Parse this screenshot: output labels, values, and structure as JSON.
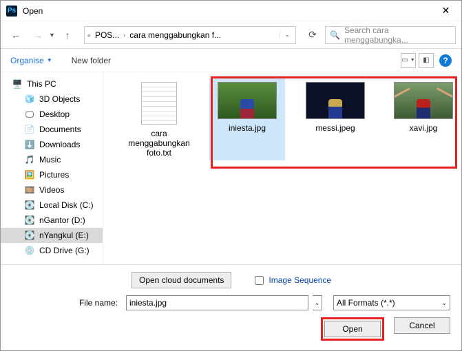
{
  "title": "Open",
  "breadcrumb": {
    "seg1": "POS...",
    "seg2": "cara menggabungkan f..."
  },
  "search_placeholder": "Search cara menggabungka...",
  "toolbar": {
    "organise": "Organise",
    "newfolder": "New folder"
  },
  "tree": {
    "thispc": "This PC",
    "objects3d": "3D Objects",
    "desktop": "Desktop",
    "documents": "Documents",
    "downloads": "Downloads",
    "music": "Music",
    "pictures": "Pictures",
    "videos": "Videos",
    "localc": "Local Disk (C:)",
    "ngantor": "nGantor (D:)",
    "nyangkul": "nYangkul (E:)",
    "cddrive": "CD Drive (G:)"
  },
  "files": {
    "txt": "cara menggabungkan foto.txt",
    "iniesta": "iniesta.jpg",
    "messi": "messi.jpeg",
    "xavi": "xavi.jpg"
  },
  "footer": {
    "cloud": "Open cloud documents",
    "imgseq": "Image Sequence",
    "filename_label": "File name:",
    "filename_value": "iniesta.jpg",
    "filter": "All Formats (*.*)",
    "open": "Open",
    "cancel": "Cancel"
  },
  "chart_data": null
}
